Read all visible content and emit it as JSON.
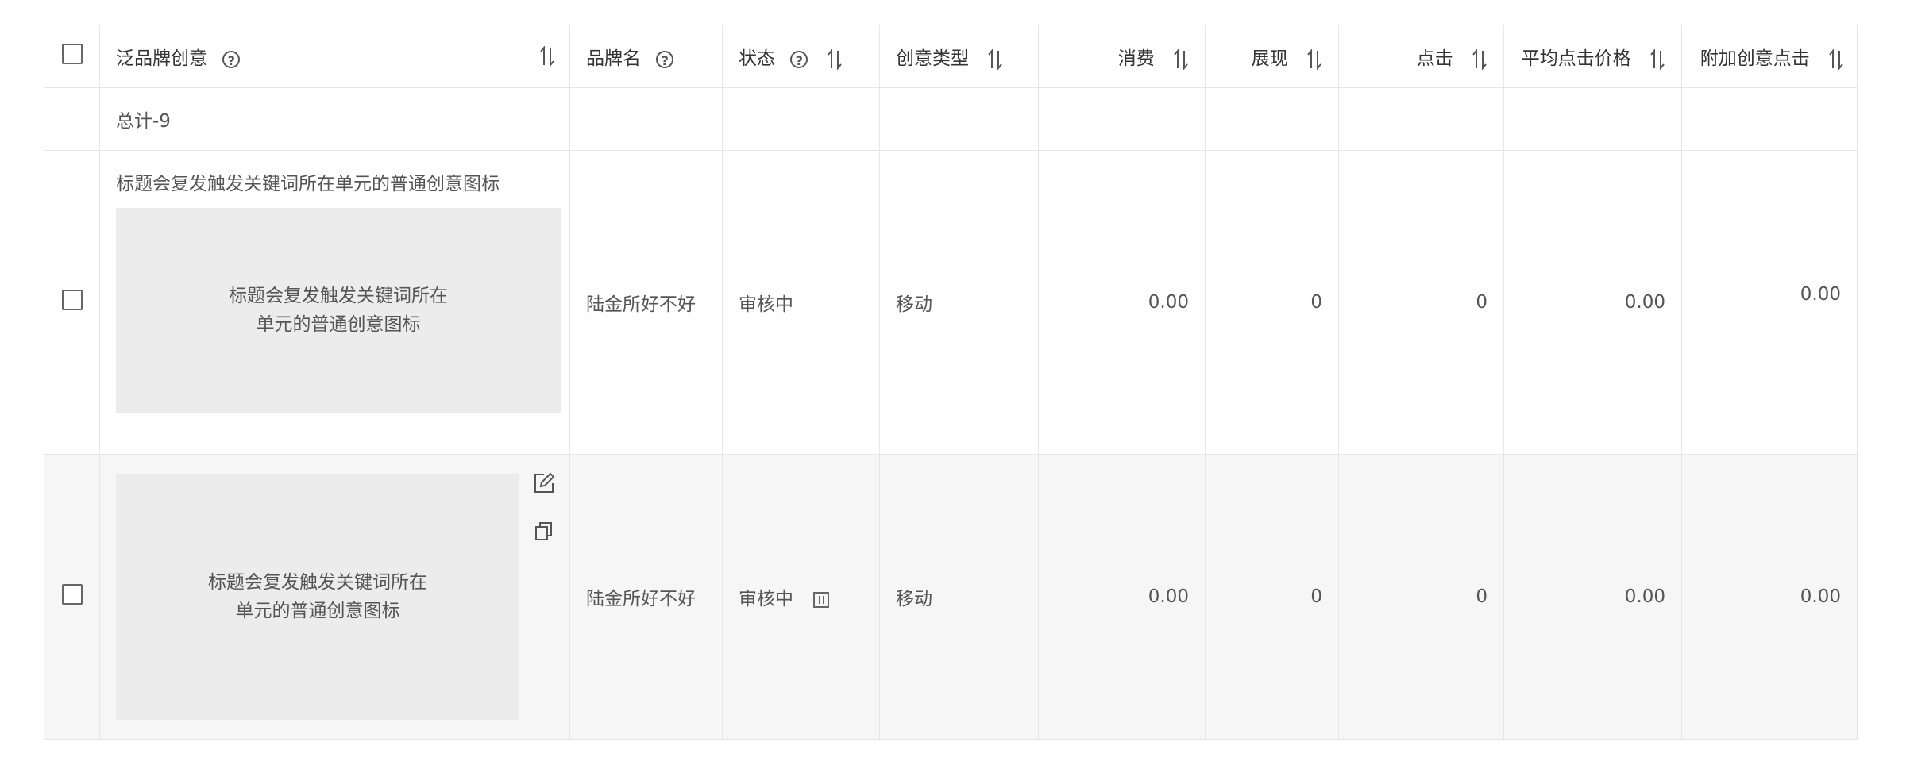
{
  "table": {
    "headers": {
      "creative": "泛品牌创意",
      "brand": "品牌名",
      "status": "状态",
      "type": "创意类型",
      "cost": "消费",
      "impressions": "展现",
      "clicks": "点击",
      "avg_cpc": "平均点击价格",
      "extra_clicks": "附加创意点击"
    },
    "total_label": "总计-9",
    "rows": [
      {
        "title": "标题会复发触发关键词所在单元的普通创意图标",
        "image_text_line1": "标题会复发触发关键词所在",
        "image_text_line2": "单元的普通创意图标",
        "brand": "陆金所好不好",
        "status": "审核中",
        "type": "移动",
        "cost": "0.00",
        "impressions": "0",
        "clicks": "0",
        "avg_cpc": "0.00",
        "extra_clicks": "0.00"
      },
      {
        "image_text_line1": "标题会复发触发关键词所在",
        "image_text_line2": "单元的普通创意图标",
        "brand": "陆金所好不好",
        "status": "审核中",
        "type": "移动",
        "cost": "0.00",
        "impressions": "0",
        "clicks": "0",
        "avg_cpc": "0.00",
        "extra_clicks": "0.00"
      }
    ]
  },
  "icons": {
    "help": "help-icon",
    "sort": "sort-icon",
    "edit": "edit-icon",
    "copy": "copy-icon",
    "pause": "pause-icon"
  },
  "colors": {
    "border": "#e6e6e6",
    "hover_row": "#f6f6f6",
    "image_placeholder": "#ececec"
  }
}
